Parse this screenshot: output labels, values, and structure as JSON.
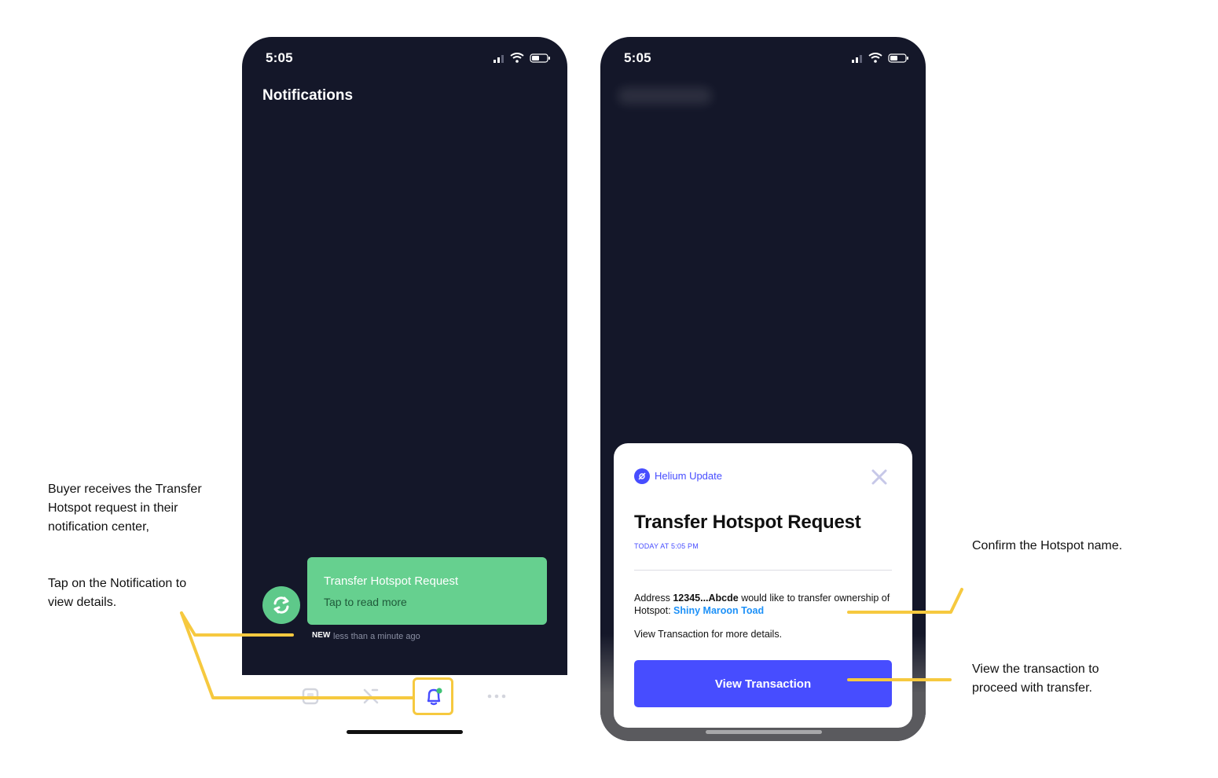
{
  "phone_left": {
    "status_time": "5:05",
    "screen_title": "Notifications",
    "notification": {
      "title": "Transfer Hotspot Request",
      "subtitle": "Tap to read more",
      "badge": "NEW",
      "time": "less than a minute ago",
      "icon": "transfer-icon"
    },
    "tabs": [
      {
        "icon": "hotspots-icon"
      },
      {
        "icon": "explore-icon"
      },
      {
        "icon": "notifications-bell-icon",
        "active": true
      },
      {
        "icon": "more-icon"
      }
    ]
  },
  "phone_right": {
    "status_time": "5:05",
    "modal": {
      "app_name": "Helium Update",
      "title": "Transfer Hotspot Request",
      "date": "TODAY AT 5:05 PM",
      "body_prefix": "Address ",
      "address": "12345...Abcde",
      "body_middle": " would like to transfer ownership of Hotspot: ",
      "hotspot_name": "Shiny Maroon Toad",
      "body_secondary": "View Transaction for more details.",
      "button_label": "View Transaction"
    }
  },
  "annotations": {
    "left_1": "Buyer receives the Transfer Hotspot request in their notification center,",
    "left_2": "Tap on the Notification to view details.",
    "right_1": "Confirm the Hotspot name.",
    "right_2": "View the transaction to proceed with transfer."
  },
  "colors": {
    "screen_bg": "#141729",
    "notification_green": "#66d08f",
    "accent_blue": "#474dff",
    "hotspot_link": "#1d91f8",
    "annotation_yellow": "#f6c93f"
  }
}
